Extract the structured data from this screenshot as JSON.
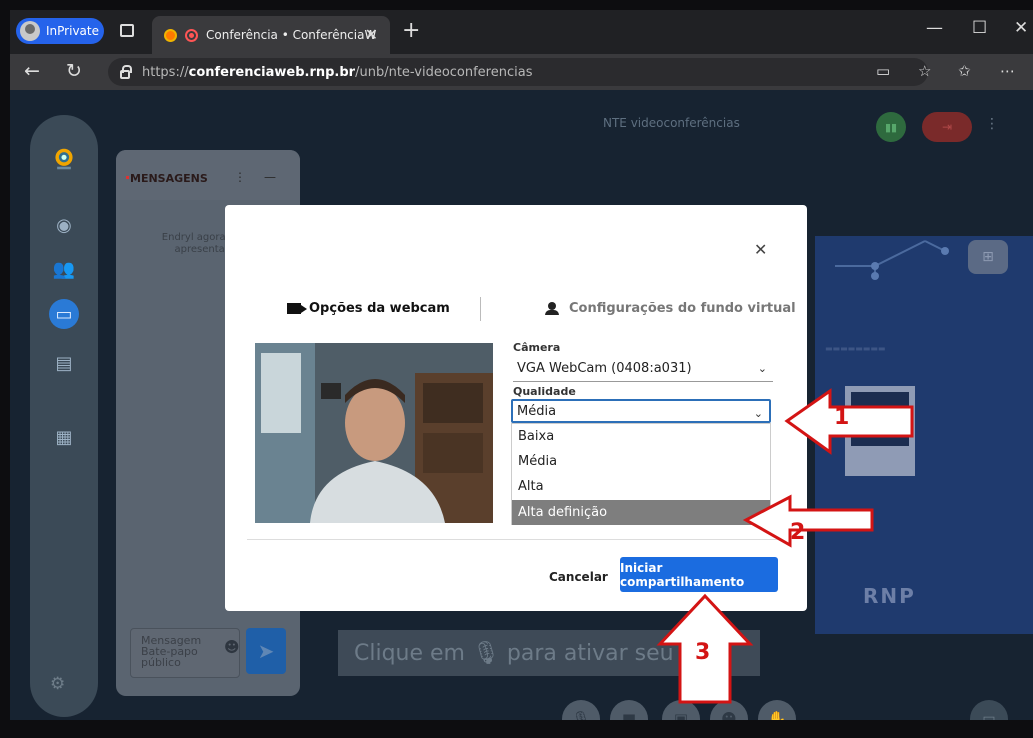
{
  "browser": {
    "profile_label": "InPrivate",
    "tab_title": "Conferência • ConferênciaW",
    "url_prefix": "https://",
    "url_domain": "conferenciaweb.rnp.br",
    "url_path": "/unb/nte-videoconferencias"
  },
  "app": {
    "room_title": "NTE videoconferências",
    "messages": {
      "title": "MENSAGENS",
      "system_note": "Endryl agora está apresentand",
      "input_placeholder": "Mensagem Bate-papo público"
    },
    "mic_hint": "Clique em 🎙 para ativar seu mic"
  },
  "modal": {
    "tab_webcam": "Opções da webcam",
    "tab_background": "Configurações do fundo virtual",
    "camera_label": "Câmera",
    "camera_value": "VGA WebCam (0408:a031)",
    "quality_label": "Qualidade",
    "quality_value": "Média",
    "quality_options": [
      "Baixa",
      "Média",
      "Alta",
      "Alta definição"
    ],
    "cancel_label": "Cancelar",
    "start_label": "Iniciar compartilhamento"
  },
  "annotations": [
    "1",
    "2",
    "3"
  ],
  "colors": {
    "primary": "#1b6ce0",
    "annotation_red": "#d31414",
    "app_bg": "#172331"
  }
}
